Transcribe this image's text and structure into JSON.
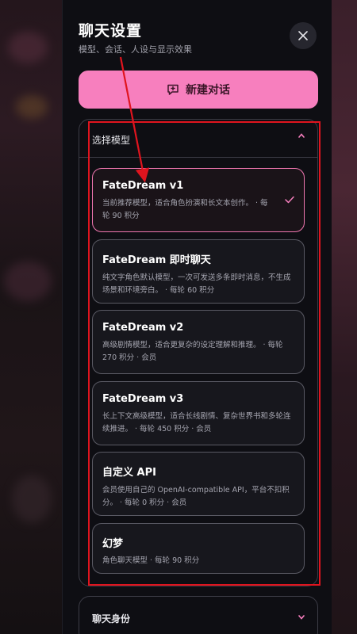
{
  "drawer": {
    "title": "聊天设置",
    "subtitle": "模型、会话、人设与显示效果",
    "close_icon": "close-icon",
    "new_chat_label": "新建对话",
    "new_chat_icon": "chat-plus-icon"
  },
  "model_section": {
    "label": "选择模型",
    "expanded": true,
    "models": [
      {
        "name": "FateDream v1",
        "desc": "当前推荐模型，适合角色扮演和长文本创作。 · 每轮 90 积分",
        "selected": true
      },
      {
        "name": "FateDream 即时聊天",
        "desc": "纯文字角色默认模型，一次可发送多条即时消息，不生成场景和环境旁白。 · 每轮 60 积分",
        "selected": false
      },
      {
        "name": "FateDream v2",
        "desc": "高级剧情模型，适合更复杂的设定理解和推理。 · 每轮 270 积分 · 会员",
        "selected": false
      },
      {
        "name": "FateDream v3",
        "desc": "长上下文高级模型，适合长线剧情、复杂世界书和多轮连续推进。 · 每轮 450 积分 · 会员",
        "selected": false
      },
      {
        "name": "自定义 API",
        "desc": "会员使用自己的 OpenAI-compatible API，平台不扣积分。 · 每轮 0 积分 · 会员",
        "selected": false
      },
      {
        "name": "幻梦",
        "desc": "角色聊天模型 · 每轮 90 积分",
        "selected": false
      }
    ]
  },
  "identity_section": {
    "label": "聊天身份",
    "expanded": false
  },
  "colors": {
    "accent": "#f77fbe",
    "annotation": "#e0141e"
  }
}
